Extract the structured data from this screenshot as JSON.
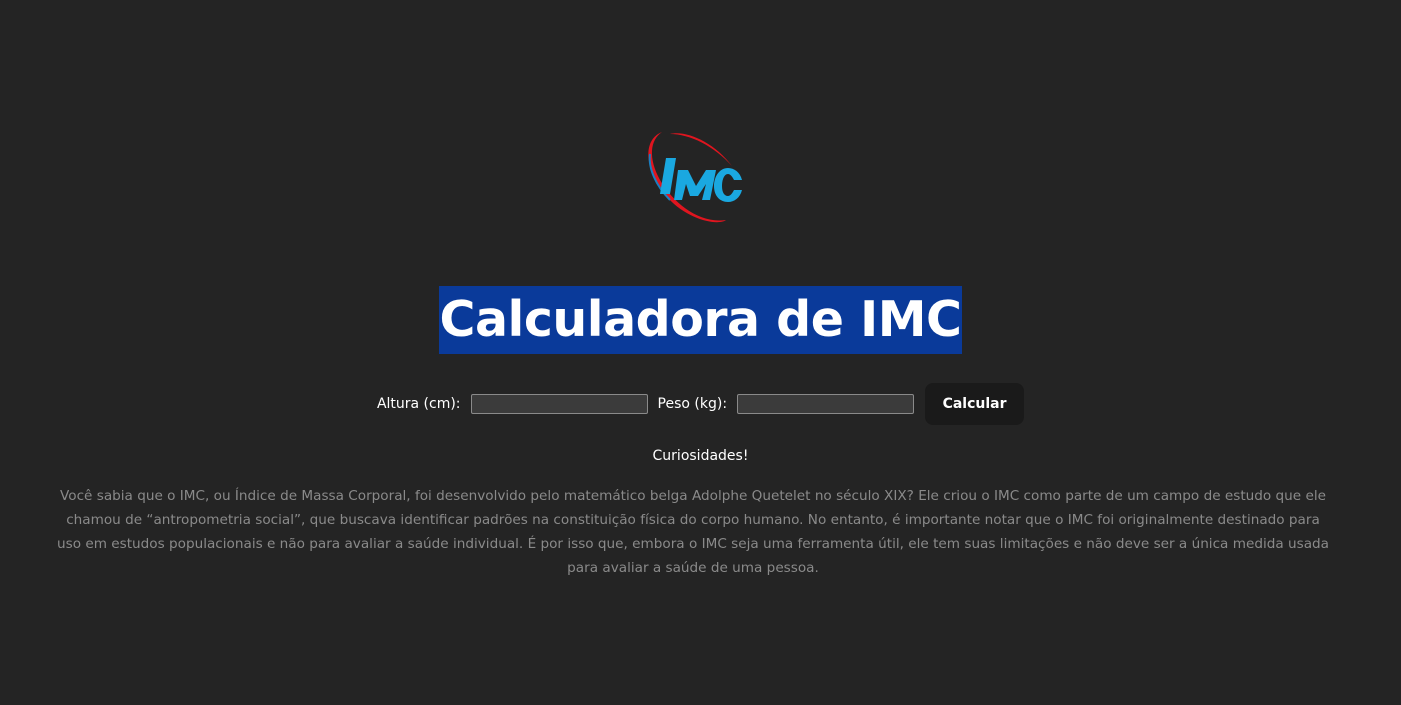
{
  "logo": {
    "text": "IMC",
    "icon": "imc-logo",
    "colors": {
      "ring": "#e0151f",
      "letters": "#1aa8e0",
      "ring_edge": "#1a7fc0"
    }
  },
  "header": {
    "title": "Calculadora de IMC",
    "title_highlight_color": "#0a3a9a"
  },
  "form": {
    "height_label": "Altura (cm):",
    "height_value": "",
    "weight_label": "Peso (kg):",
    "weight_value": "",
    "submit_label": "Calcular"
  },
  "curiosities": {
    "heading": "Curiosidades!",
    "text": "Você sabia que o IMC, ou Índice de Massa Corporal, foi desenvolvido pelo matemático belga Adolphe Quetelet no século XIX? Ele criou o IMC como parte de um campo de estudo que ele chamou de “antropometria social”, que buscava identificar padrões na constituição física do corpo humano. No entanto, é importante notar que o IMC foi originalmente destinado para uso em estudos populacionais e não para avaliar a saúde individual. É por isso que, embora o IMC seja uma ferramenta útil, ele tem suas limitações e não deve ser a única medida usada para avaliar a saúde de uma pessoa."
  },
  "theme": {
    "background": "#242424",
    "button_background": "#1a1a1a",
    "muted_text": "#8a8a8a"
  }
}
